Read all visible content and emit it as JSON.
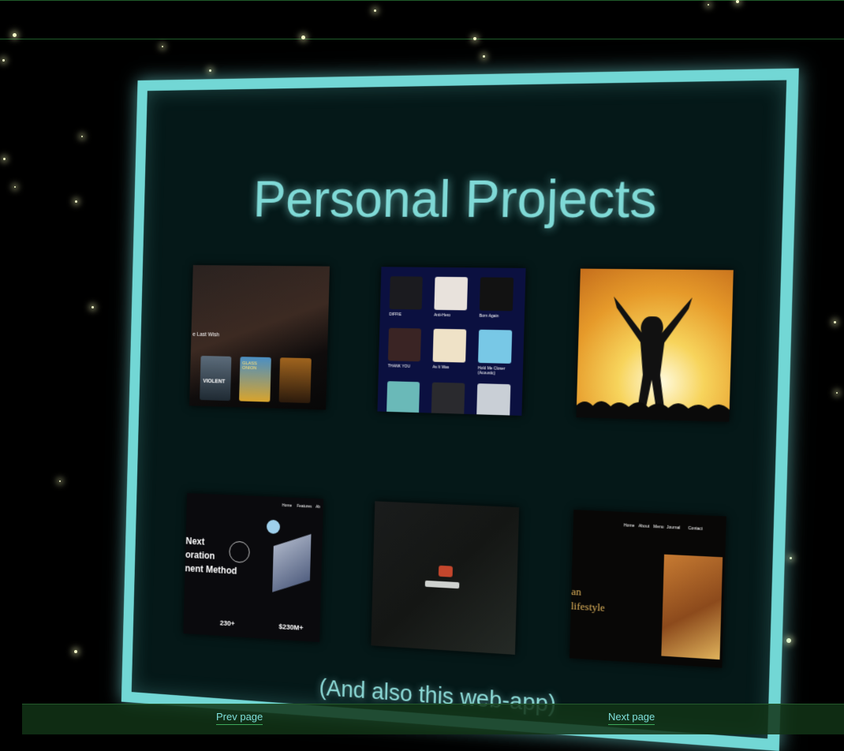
{
  "panel": {
    "title": "Personal Projects",
    "caption": "(And also this web-app)",
    "accent": "#72d7d5",
    "background": "#051818"
  },
  "projects": [
    {
      "id": "movie-site",
      "heading": "e Last Wish",
      "poster_labels": [
        "VIOLENT",
        "GLASS ONION",
        ""
      ]
    },
    {
      "id": "music-app",
      "tracks": [
        "DIFFIE",
        "Anti-Hero",
        "Born Again",
        "THANK YOU",
        "As It Was",
        "Hold Me Closer (Acoustic)"
      ]
    },
    {
      "id": "concert-photo"
    },
    {
      "id": "fintech-landing",
      "nav": [
        "Home",
        "Features",
        "Ab"
      ],
      "headline_lines": [
        "Next",
        "oration",
        "nent Method"
      ],
      "stats": [
        "230+",
        "$230M+"
      ]
    },
    {
      "id": "dark-photo"
    },
    {
      "id": "food-blog",
      "nav": [
        "Home",
        "About",
        "Menu",
        "Journal",
        "Contact"
      ],
      "headline_lines": [
        "an",
        "lifestyle"
      ]
    }
  ],
  "footer": {
    "prev_label": "Prev page",
    "next_label": "Next page"
  }
}
